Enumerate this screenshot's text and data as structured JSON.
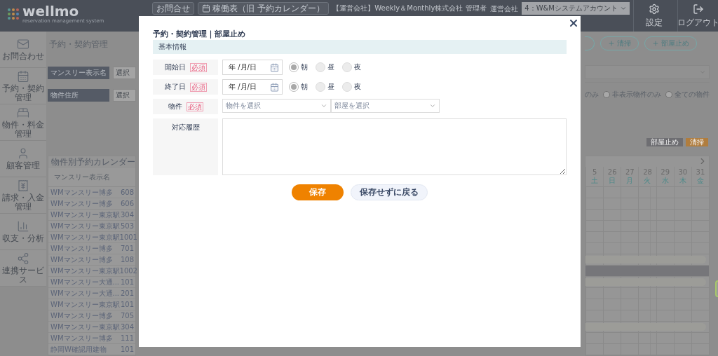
{
  "header": {
    "logo": "wellmo",
    "tagline": "reservation management system",
    "buttons": [
      {
        "label": "お問合せ",
        "kind": "text"
      },
      {
        "label": "稼働表（旧 予約カレンダー）",
        "kind": "calendar"
      }
    ],
    "company": "【運営会社】Weekly＆Monthly株式会社",
    "role": "管理者",
    "company_label": "運営会社",
    "company_select": "4：W&Mシステムアカウント",
    "actions": [
      {
        "label": "設定",
        "kind": "settings"
      },
      {
        "label": "ログアウト",
        "kind": "logout"
      }
    ]
  },
  "sidebar": {
    "items": [
      {
        "label": "お問合わせ",
        "kind": "mail"
      },
      {
        "label": "予約・契約管理",
        "kind": "calendar"
      },
      {
        "label": "物件・料金管理",
        "kind": "bed"
      },
      {
        "label": "顧客管理",
        "kind": "user"
      },
      {
        "label": "請求・入金管理",
        "kind": "invoice"
      },
      {
        "label": "収支・分析",
        "kind": "chart"
      },
      {
        "label": "連携サービス",
        "kind": "link"
      }
    ]
  },
  "page": {
    "title": "予約・契約管理",
    "filters": [
      {
        "label": "マンスリー表示名",
        "placeholder": "選択"
      },
      {
        "label": "物件住所",
        "placeholder": "選択"
      }
    ],
    "action_buttons": [
      {
        "label": "清掃"
      },
      {
        "label": "部屋止め"
      }
    ],
    "option_fragment": "のみ",
    "display_options": [
      {
        "label": "非表示物件のみ",
        "selected": false
      },
      {
        "label": "全ての物件",
        "selected": false
      }
    ],
    "legend": [
      {
        "label": "部屋止め",
        "color": "#6e6e72"
      },
      {
        "label": "清掃",
        "color": "#b07d3e"
      }
    ]
  },
  "calendar": {
    "title": "物件別予約カレンダー",
    "name_header": "マンスリー表示名",
    "days": [
      {
        "day": "5",
        "weekday": "土"
      },
      {
        "day": "26",
        "weekday": "日"
      },
      {
        "day": "27",
        "weekday": "月"
      },
      {
        "day": "28",
        "weekday": "火"
      },
      {
        "day": "29",
        "weekday": "水"
      },
      {
        "day": "30",
        "weekday": "木"
      },
      {
        "day": "31",
        "weekday": "金"
      }
    ],
    "rows": [
      {
        "name": "WMマンスリー博多",
        "room": "608",
        "kind": "empty"
      },
      {
        "name": "WMマンスリー博多",
        "room": "606",
        "kind": "empty"
      },
      {
        "name": "WMマンスリー東京駅",
        "room": "304",
        "kind": "empty"
      },
      {
        "name": "WMマンスリー東京駅",
        "room": "503",
        "kind": "empty"
      },
      {
        "name": "WMマンスリー東京駅",
        "room": "1001",
        "kind": "empty"
      },
      {
        "name": "WMマンスリー博多",
        "room": "701",
        "kind": "empty"
      },
      {
        "name": "WMマンスリー博多",
        "room": "108",
        "kind": "stay"
      },
      {
        "name": "WMマンスリー東京駅",
        "room": "1002",
        "kind": "block"
      },
      {
        "name": "WMマンスリー大通...",
        "room": "101",
        "kind": "stay"
      },
      {
        "name": "WMマンスリー大通...",
        "room": "201",
        "kind": "empty"
      },
      {
        "name": "WMマンスリー東京駅",
        "room": "101",
        "kind": "empty"
      },
      {
        "name": "WMマンスリー博多",
        "room": "705",
        "kind": "empty"
      },
      {
        "name": "WMマンスリー東京駅",
        "room": "304",
        "kind": "stay"
      },
      {
        "name": "WMマンスリー博多",
        "room": "111",
        "kind": "empty"
      },
      {
        "name": "静岡W確認用建物",
        "room": "101",
        "kind": "empty"
      }
    ]
  },
  "modal": {
    "title": "予約・契約管理｜部屋止め",
    "section": "基本情報",
    "fields": [
      {
        "kind": "date",
        "label": "開始日",
        "required": "必須",
        "value": "年 /月/日",
        "times": [
          {
            "label": "朝",
            "selected": true
          },
          {
            "label": "昼",
            "selected": false
          },
          {
            "label": "夜",
            "selected": false
          }
        ]
      },
      {
        "kind": "date",
        "label": "終了日",
        "required": "必須",
        "value": "年 /月/日",
        "times": [
          {
            "label": "朝",
            "selected": true
          },
          {
            "label": "昼",
            "selected": false
          },
          {
            "label": "夜",
            "selected": false
          }
        ]
      },
      {
        "kind": "selects",
        "label": "物件",
        "required": "必須",
        "selects": [
          {
            "placeholder": "物件を選択"
          },
          {
            "placeholder": "部屋を選択"
          }
        ]
      },
      {
        "kind": "textarea",
        "label": "対応履歴"
      }
    ],
    "buttons": [
      {
        "label": "保存",
        "kind": "primary"
      },
      {
        "label": "保存せずに戻る",
        "kind": "secondary"
      }
    ]
  }
}
